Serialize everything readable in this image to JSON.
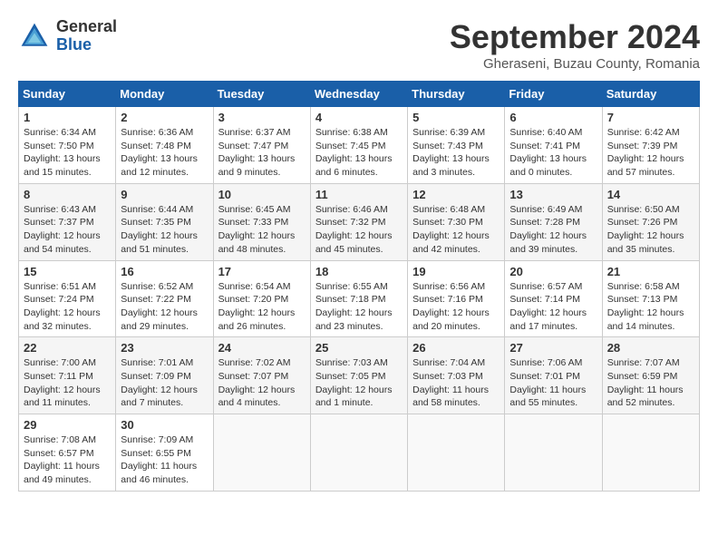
{
  "header": {
    "logo_general": "General",
    "logo_blue": "Blue",
    "month_title": "September 2024",
    "subtitle": "Gheraseni, Buzau County, Romania"
  },
  "weekdays": [
    "Sunday",
    "Monday",
    "Tuesday",
    "Wednesday",
    "Thursday",
    "Friday",
    "Saturday"
  ],
  "weeks": [
    [
      {
        "day": "1",
        "sunrise": "6:34 AM",
        "sunset": "7:50 PM",
        "daylight": "13 hours and 15 minutes."
      },
      {
        "day": "2",
        "sunrise": "6:36 AM",
        "sunset": "7:48 PM",
        "daylight": "13 hours and 12 minutes."
      },
      {
        "day": "3",
        "sunrise": "6:37 AM",
        "sunset": "7:47 PM",
        "daylight": "13 hours and 9 minutes."
      },
      {
        "day": "4",
        "sunrise": "6:38 AM",
        "sunset": "7:45 PM",
        "daylight": "13 hours and 6 minutes."
      },
      {
        "day": "5",
        "sunrise": "6:39 AM",
        "sunset": "7:43 PM",
        "daylight": "13 hours and 3 minutes."
      },
      {
        "day": "6",
        "sunrise": "6:40 AM",
        "sunset": "7:41 PM",
        "daylight": "13 hours and 0 minutes."
      },
      {
        "day": "7",
        "sunrise": "6:42 AM",
        "sunset": "7:39 PM",
        "daylight": "12 hours and 57 minutes."
      }
    ],
    [
      {
        "day": "8",
        "sunrise": "6:43 AM",
        "sunset": "7:37 PM",
        "daylight": "12 hours and 54 minutes."
      },
      {
        "day": "9",
        "sunrise": "6:44 AM",
        "sunset": "7:35 PM",
        "daylight": "12 hours and 51 minutes."
      },
      {
        "day": "10",
        "sunrise": "6:45 AM",
        "sunset": "7:33 PM",
        "daylight": "12 hours and 48 minutes."
      },
      {
        "day": "11",
        "sunrise": "6:46 AM",
        "sunset": "7:32 PM",
        "daylight": "12 hours and 45 minutes."
      },
      {
        "day": "12",
        "sunrise": "6:48 AM",
        "sunset": "7:30 PM",
        "daylight": "12 hours and 42 minutes."
      },
      {
        "day": "13",
        "sunrise": "6:49 AM",
        "sunset": "7:28 PM",
        "daylight": "12 hours and 39 minutes."
      },
      {
        "day": "14",
        "sunrise": "6:50 AM",
        "sunset": "7:26 PM",
        "daylight": "12 hours and 35 minutes."
      }
    ],
    [
      {
        "day": "15",
        "sunrise": "6:51 AM",
        "sunset": "7:24 PM",
        "daylight": "12 hours and 32 minutes."
      },
      {
        "day": "16",
        "sunrise": "6:52 AM",
        "sunset": "7:22 PM",
        "daylight": "12 hours and 29 minutes."
      },
      {
        "day": "17",
        "sunrise": "6:54 AM",
        "sunset": "7:20 PM",
        "daylight": "12 hours and 26 minutes."
      },
      {
        "day": "18",
        "sunrise": "6:55 AM",
        "sunset": "7:18 PM",
        "daylight": "12 hours and 23 minutes."
      },
      {
        "day": "19",
        "sunrise": "6:56 AM",
        "sunset": "7:16 PM",
        "daylight": "12 hours and 20 minutes."
      },
      {
        "day": "20",
        "sunrise": "6:57 AM",
        "sunset": "7:14 PM",
        "daylight": "12 hours and 17 minutes."
      },
      {
        "day": "21",
        "sunrise": "6:58 AM",
        "sunset": "7:13 PM",
        "daylight": "12 hours and 14 minutes."
      }
    ],
    [
      {
        "day": "22",
        "sunrise": "7:00 AM",
        "sunset": "7:11 PM",
        "daylight": "12 hours and 11 minutes."
      },
      {
        "day": "23",
        "sunrise": "7:01 AM",
        "sunset": "7:09 PM",
        "daylight": "12 hours and 7 minutes."
      },
      {
        "day": "24",
        "sunrise": "7:02 AM",
        "sunset": "7:07 PM",
        "daylight": "12 hours and 4 minutes."
      },
      {
        "day": "25",
        "sunrise": "7:03 AM",
        "sunset": "7:05 PM",
        "daylight": "12 hours and 1 minute."
      },
      {
        "day": "26",
        "sunrise": "7:04 AM",
        "sunset": "7:03 PM",
        "daylight": "11 hours and 58 minutes."
      },
      {
        "day": "27",
        "sunrise": "7:06 AM",
        "sunset": "7:01 PM",
        "daylight": "11 hours and 55 minutes."
      },
      {
        "day": "28",
        "sunrise": "7:07 AM",
        "sunset": "6:59 PM",
        "daylight": "11 hours and 52 minutes."
      }
    ],
    [
      {
        "day": "29",
        "sunrise": "7:08 AM",
        "sunset": "6:57 PM",
        "daylight": "11 hours and 49 minutes."
      },
      {
        "day": "30",
        "sunrise": "7:09 AM",
        "sunset": "6:55 PM",
        "daylight": "11 hours and 46 minutes."
      },
      null,
      null,
      null,
      null,
      null
    ]
  ]
}
